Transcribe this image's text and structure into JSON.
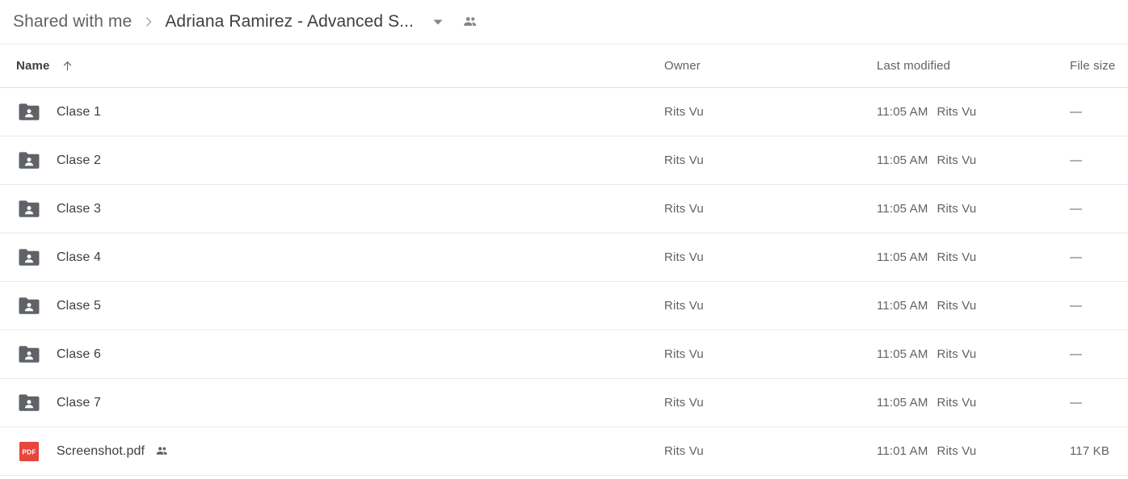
{
  "breadcrumb": {
    "root_label": "Shared with me",
    "separator_icon": "chevron-right-icon",
    "current_label": "Adriana Ramirez - Advanced S...",
    "caret_icon": "chevron-down-icon",
    "people_icon": "people-shared-icon"
  },
  "columns": {
    "name": "Name",
    "owner": "Owner",
    "last_modified": "Last modified",
    "file_size": "File size",
    "sort_icon": "arrow-up-icon",
    "sorted_by": "Name",
    "sort_direction": "ascending"
  },
  "colors": {
    "folder_icon": "#5f6368",
    "pdf_icon": "#e8453c",
    "divider": "#e8eaed",
    "primary_text": "#3c4043",
    "secondary_text": "#5f6368"
  },
  "rows": [
    {
      "icon": "shared-folder-icon",
      "name": "Clase 1",
      "shared": false,
      "owner": "Rits Vu",
      "modified_time": "11:05 AM",
      "modified_by": "Rits Vu",
      "size": "—"
    },
    {
      "icon": "shared-folder-icon",
      "name": "Clase 2",
      "shared": false,
      "owner": "Rits Vu",
      "modified_time": "11:05 AM",
      "modified_by": "Rits Vu",
      "size": "—"
    },
    {
      "icon": "shared-folder-icon",
      "name": "Clase 3",
      "shared": false,
      "owner": "Rits Vu",
      "modified_time": "11:05 AM",
      "modified_by": "Rits Vu",
      "size": "—"
    },
    {
      "icon": "shared-folder-icon",
      "name": "Clase 4",
      "shared": false,
      "owner": "Rits Vu",
      "modified_time": "11:05 AM",
      "modified_by": "Rits Vu",
      "size": "—"
    },
    {
      "icon": "shared-folder-icon",
      "name": "Clase 5",
      "shared": false,
      "owner": "Rits Vu",
      "modified_time": "11:05 AM",
      "modified_by": "Rits Vu",
      "size": "—"
    },
    {
      "icon": "shared-folder-icon",
      "name": "Clase 6",
      "shared": false,
      "owner": "Rits Vu",
      "modified_time": "11:05 AM",
      "modified_by": "Rits Vu",
      "size": "—"
    },
    {
      "icon": "shared-folder-icon",
      "name": "Clase 7",
      "shared": false,
      "owner": "Rits Vu",
      "modified_time": "11:05 AM",
      "modified_by": "Rits Vu",
      "size": "—"
    },
    {
      "icon": "pdf-file-icon",
      "name": "Screenshot.pdf",
      "shared": true,
      "owner": "Rits Vu",
      "modified_time": "11:01 AM",
      "modified_by": "Rits Vu",
      "size": "117 KB"
    }
  ]
}
